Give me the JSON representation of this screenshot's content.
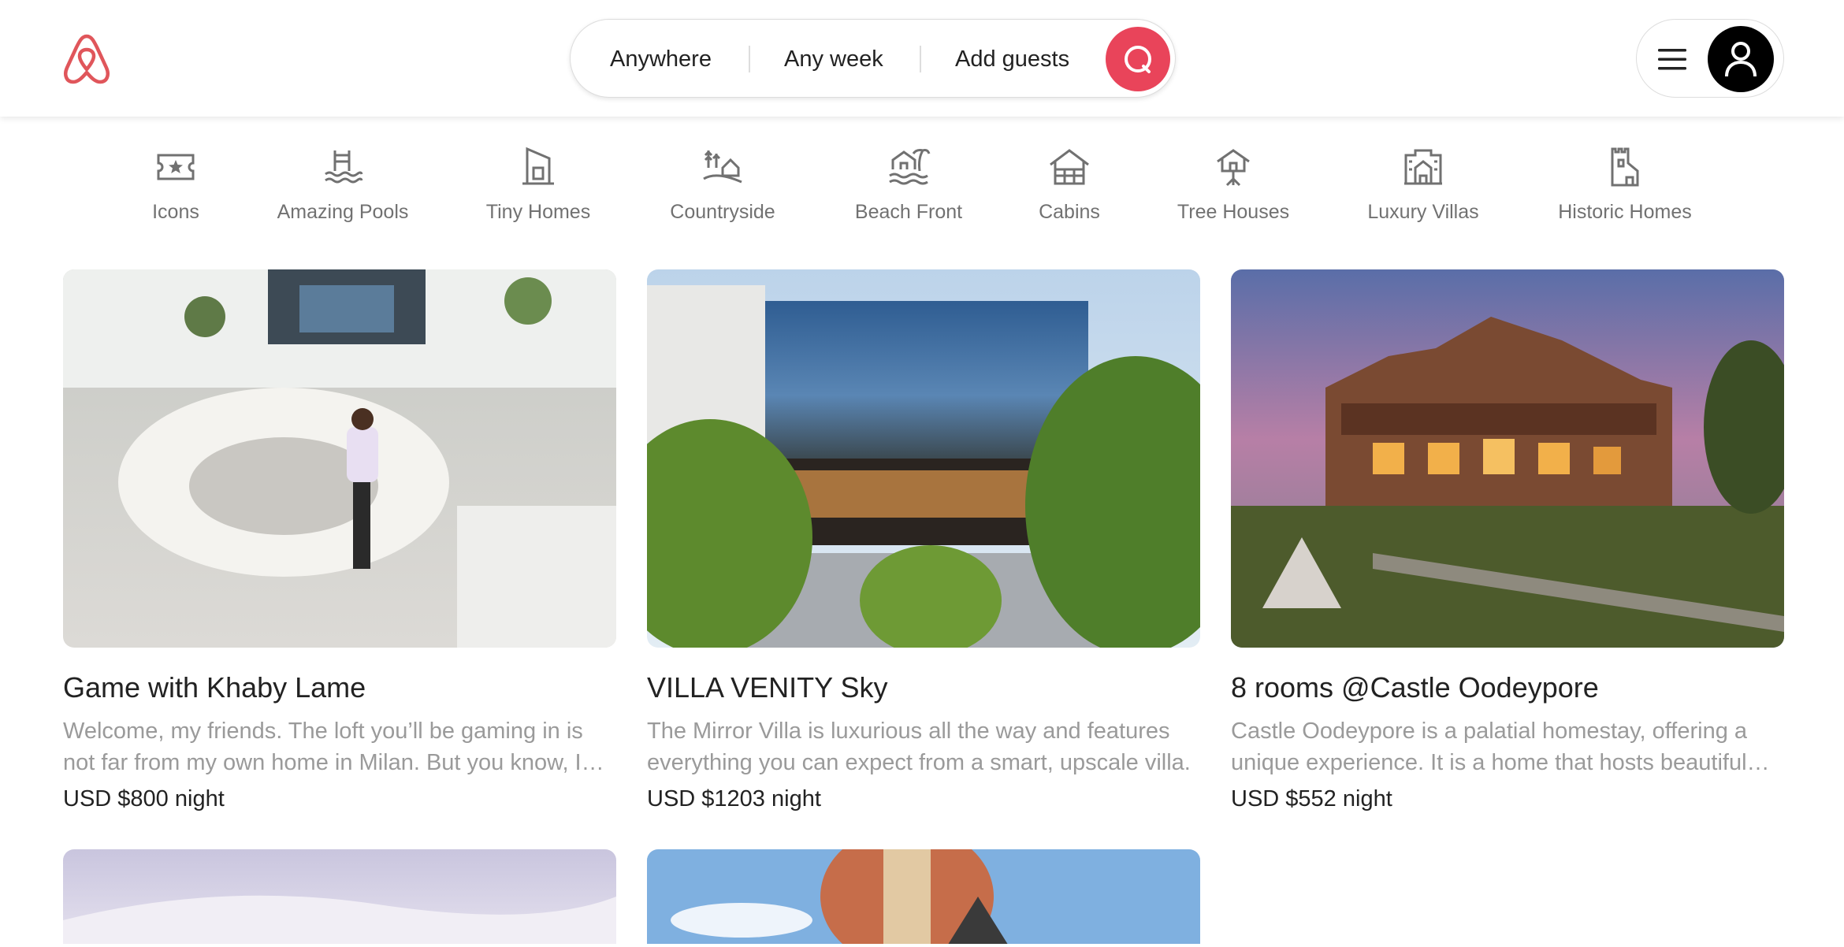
{
  "header": {
    "logo_icon": "airbnb-logo-icon",
    "brand_color": "#e9445a",
    "search": {
      "anywhere_label": "Anywhere",
      "any_week_label": "Any week",
      "add_guests_label": "Add guests",
      "search_icon": "search-icon"
    },
    "menu_icon": "hamburger-menu-icon",
    "avatar_icon": "user-icon"
  },
  "categories": [
    {
      "label": "Icons",
      "icon": "ticket-star-icon"
    },
    {
      "label": "Amazing Pools",
      "icon": "pool-icon"
    },
    {
      "label": "Tiny Homes",
      "icon": "tiny-home-icon"
    },
    {
      "label": "Countryside",
      "icon": "countryside-icon"
    },
    {
      "label": "Beach Front",
      "icon": "beach-icon"
    },
    {
      "label": "Cabins",
      "icon": "cabin-icon"
    },
    {
      "label": "Tree Houses",
      "icon": "tree-house-icon"
    },
    {
      "label": "Luxury Villas",
      "icon": "villa-icon"
    },
    {
      "label": "Historic Homes",
      "icon": "castle-icon"
    }
  ],
  "listings": [
    {
      "title": "Game with Khaby Lame",
      "description": "Welcome, my friends. The loft you’ll be gaming in is not far from my own home in Milan. But you know, I have a surprise for you.",
      "price": "USD $800",
      "unit": "night"
    },
    {
      "title": "VILLA VENITY Sky",
      "description": "The Mirror Villa is luxurious all the way and features everything you can expect from a smart, upscale villa.",
      "price": "USD $1203",
      "unit": "night"
    },
    {
      "title": "8 rooms @Castle Oodeypore",
      "description": "Castle Oodeypore is a palatial homestay, offering a unique experience. It is a home that hosts beautiful rooms.",
      "price": "USD $552",
      "unit": "night"
    }
  ]
}
